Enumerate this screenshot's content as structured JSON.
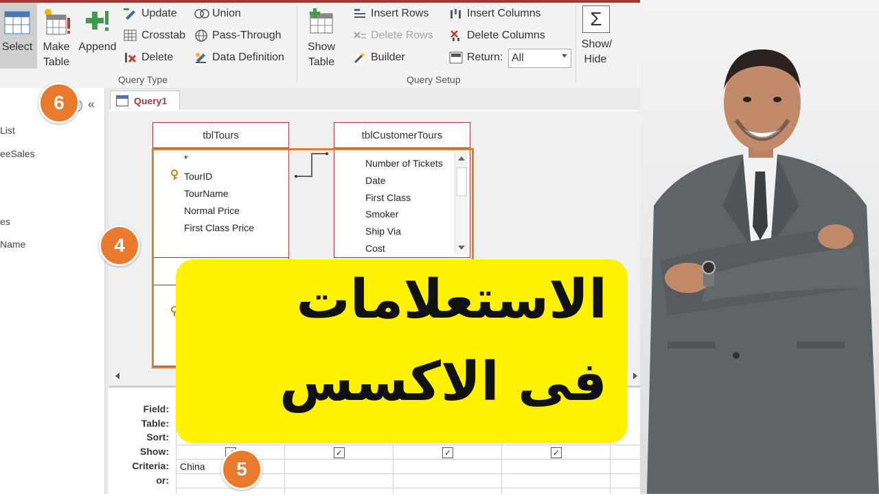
{
  "ribbon": {
    "select_label": "Select",
    "make_table_line1": "Make",
    "make_table_line2": "Table",
    "append_label": "Append",
    "update_label": "Update",
    "crosstab_label": "Crosstab",
    "delete_label": "Delete",
    "union_label": "Union",
    "pass_through_label": "Pass-Through",
    "data_definition_label": "Data Definition",
    "query_type_group": "Query Type",
    "show_table_line1": "Show",
    "show_table_line2": "Table",
    "insert_rows_label": "Insert Rows",
    "delete_rows_label": "Delete Rows",
    "builder_label": "Builder",
    "insert_columns_label": "Insert Columns",
    "delete_columns_label": "Delete Columns",
    "return_label": "Return:",
    "return_value": "All",
    "query_setup_group": "Query Setup",
    "show_hide_line1": "Show/",
    "show_hide_line2": "Hide",
    "sigma_symbol": "Σ"
  },
  "nav": {
    "collapse_icon": "«",
    "items": [
      "List",
      "eeSales",
      "es",
      "Name"
    ]
  },
  "document": {
    "tab_label": "Query1",
    "table1": {
      "title": "tblTours",
      "fields": [
        "*",
        "TourID",
        "TourName",
        "Normal Price",
        "First Class Price"
      ]
    },
    "table2": {
      "title": "tblCustomerTours",
      "fields": [
        "Number of Tickets",
        "Date",
        "First Class",
        "Smoker",
        "Ship Via",
        "Cost"
      ]
    }
  },
  "grid": {
    "row_labels": [
      "Field:",
      "Table:",
      "Sort:",
      "Show:",
      "Criteria:",
      "or:"
    ],
    "criteria_value": "China",
    "check_mark": "✓"
  },
  "callouts": {
    "c4": "4",
    "c5": "5",
    "c6": "6"
  },
  "banner": {
    "line1": "الاستعلامات",
    "line2": "فى الاكسس"
  },
  "colors": {
    "access_accent": "#a4373a",
    "callout": "#e97a2d",
    "banner": "#fff200"
  }
}
